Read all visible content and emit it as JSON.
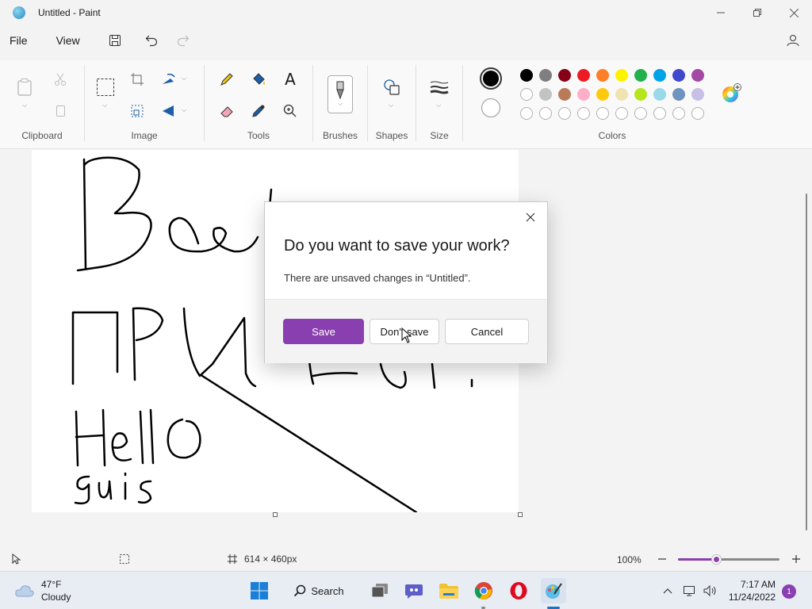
{
  "window": {
    "title": "Untitled - Paint"
  },
  "menu": {
    "file": "File",
    "view": "View"
  },
  "ribbon": {
    "groups": {
      "clipboard": "Clipboard",
      "image": "Image",
      "tools": "Tools",
      "brushes": "Brushes",
      "shapes": "Shapes",
      "size": "Size",
      "colors": "Colors"
    },
    "palette_row1": [
      "#000000",
      "#7f7f7f",
      "#880015",
      "#ed1c24",
      "#ff7f27",
      "#fff200",
      "#22b14c",
      "#00a2e8",
      "#3f48cc",
      "#a349a4"
    ],
    "palette_row2": [
      "#ffffff",
      "#c3c3c3",
      "#b97a57",
      "#ffaec9",
      "#ffc90e",
      "#efe4b0",
      "#b5e61d",
      "#99d9ea",
      "#7092be",
      "#c8bfe7"
    ],
    "primary_color": "#000000",
    "secondary_color": "#ffffff"
  },
  "dialog": {
    "title": "Do you want to save your work?",
    "message": "There are unsaved changes in “Untitled”.",
    "save": "Save",
    "dont_save": "Don't save",
    "cancel": "Cancel"
  },
  "status": {
    "canvas_size": "614 × 460px",
    "zoom": "100%",
    "zoom_level": 0.38
  },
  "taskbar": {
    "temperature": "47°F",
    "weather": "Cloudy",
    "search": "Search",
    "time": "7:17 AM",
    "date": "11/24/2022",
    "notifications": "1"
  }
}
